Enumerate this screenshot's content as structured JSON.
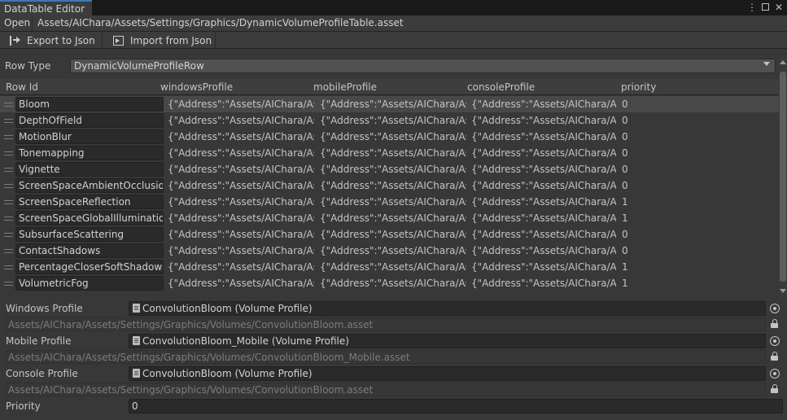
{
  "window": {
    "tab_title": "DataTable Editor",
    "menu_icon": "vertical-ellipsis-icon",
    "maximize_icon": "maximize-icon",
    "close_icon": "close-icon"
  },
  "pathbar": {
    "open_label": "Open",
    "path": "Assets/AIChara/Assets/Settings/Graphics/DynamicVolumeProfileTable.asset"
  },
  "toolbar": {
    "export_label": "Export to Json",
    "import_label": "Import from Json"
  },
  "row_type": {
    "label": "Row Type",
    "value": "DynamicVolumeProfileRow"
  },
  "table": {
    "columns": [
      "Row Id",
      "windowsProfile",
      "mobileProfile",
      "consoleProfile",
      "priority"
    ],
    "rows": [
      {
        "id": "Bloom",
        "windows": "{\"Address\":\"Assets/AIChara/Assets",
        "mobile": "{\"Address\":\"Assets/AIChara/Assets",
        "console": "{\"Address\":\"Assets/AIChara/Assets",
        "priority": "0"
      },
      {
        "id": "DepthOfField",
        "windows": "{\"Address\":\"Assets/AIChara/Assets",
        "mobile": "{\"Address\":\"Assets/AIChara/Assets",
        "console": "{\"Address\":\"Assets/AIChara/Assets",
        "priority": "0"
      },
      {
        "id": "MotionBlur",
        "windows": "{\"Address\":\"Assets/AIChara/Assets",
        "mobile": "{\"Address\":\"Assets/AIChara/Assets",
        "console": "{\"Address\":\"Assets/AIChara/Assets",
        "priority": "0"
      },
      {
        "id": "Tonemapping",
        "windows": "{\"Address\":\"Assets/AIChara/Assets",
        "mobile": "{\"Address\":\"Assets/AIChara/Assets",
        "console": "{\"Address\":\"Assets/AIChara/Assets",
        "priority": "0"
      },
      {
        "id": "Vignette",
        "windows": "{\"Address\":\"Assets/AIChara/Assets",
        "mobile": "{\"Address\":\"Assets/AIChara/Assets",
        "console": "{\"Address\":\"Assets/AIChara/Assets",
        "priority": "0"
      },
      {
        "id": "ScreenSpaceAmbientOcclusion",
        "windows": "{\"Address\":\"Assets/AIChara/Assets",
        "mobile": "{\"Address\":\"Assets/AIChara/Assets",
        "console": "{\"Address\":\"Assets/AIChara/Assets",
        "priority": "0"
      },
      {
        "id": "ScreenSpaceReflection",
        "windows": "{\"Address\":\"Assets/AIChara/Assets",
        "mobile": "{\"Address\":\"Assets/AIChara/Assets",
        "console": "{\"Address\":\"Assets/AIChara/Assets",
        "priority": "1"
      },
      {
        "id": "ScreenSpaceGlobalIllumination",
        "windows": "{\"Address\":\"Assets/AIChara/Assets",
        "mobile": "{\"Address\":\"Assets/AIChara/Assets",
        "console": "{\"Address\":\"Assets/AIChara/Assets",
        "priority": "1"
      },
      {
        "id": "SubsurfaceScattering",
        "windows": "{\"Address\":\"Assets/AIChara/Assets",
        "mobile": "{\"Address\":\"Assets/AIChara/Assets",
        "console": "{\"Address\":\"Assets/AIChara/Assets",
        "priority": "0"
      },
      {
        "id": "ContactShadows",
        "windows": "{\"Address\":\"Assets/AIChara/Assets",
        "mobile": "{\"Address\":\"Assets/AIChara/Assets",
        "console": "{\"Address\":\"Assets/AIChara/Assets",
        "priority": "0"
      },
      {
        "id": "PercentageCloserSoftShadows",
        "windows": "{\"Address\":\"Assets/AIChara/Assets",
        "mobile": "{\"Address\":\"Assets/AIChara/Assets",
        "console": "{\"Address\":\"Assets/AIChara/Assets",
        "priority": "1"
      },
      {
        "id": "VolumetricFog",
        "windows": "{\"Address\":\"Assets/AIChara/Assets",
        "mobile": "{\"Address\":\"Assets/AIChara/Assets",
        "console": "{\"Address\":\"Assets/AIChara/Assets",
        "priority": "1"
      }
    ]
  },
  "properties": {
    "windows_label": "Windows Profile",
    "windows_value": "ConvolutionBloom (Volume Profile)",
    "windows_path": "Assets/AIChara/Assets/Settings/Graphics/Volumes/ConvolutionBloom.asset",
    "mobile_label": "Mobile Profile",
    "mobile_value": "ConvolutionBloom_Mobile (Volume Profile)",
    "mobile_path": "Assets/AIChara/Assets/Settings/Graphics/Volumes/ConvolutionBloom_Mobile.asset",
    "console_label": "Console Profile",
    "console_value": "ConvolutionBloom (Volume Profile)",
    "console_path": "Assets/AIChara/Assets/Settings/Graphics/Volumes/ConvolutionBloom.asset",
    "priority_label": "Priority",
    "priority_value": "0"
  },
  "colors": {
    "background": "#383838",
    "tab_accent": "#3a79bb",
    "selected_row": "#484848"
  }
}
